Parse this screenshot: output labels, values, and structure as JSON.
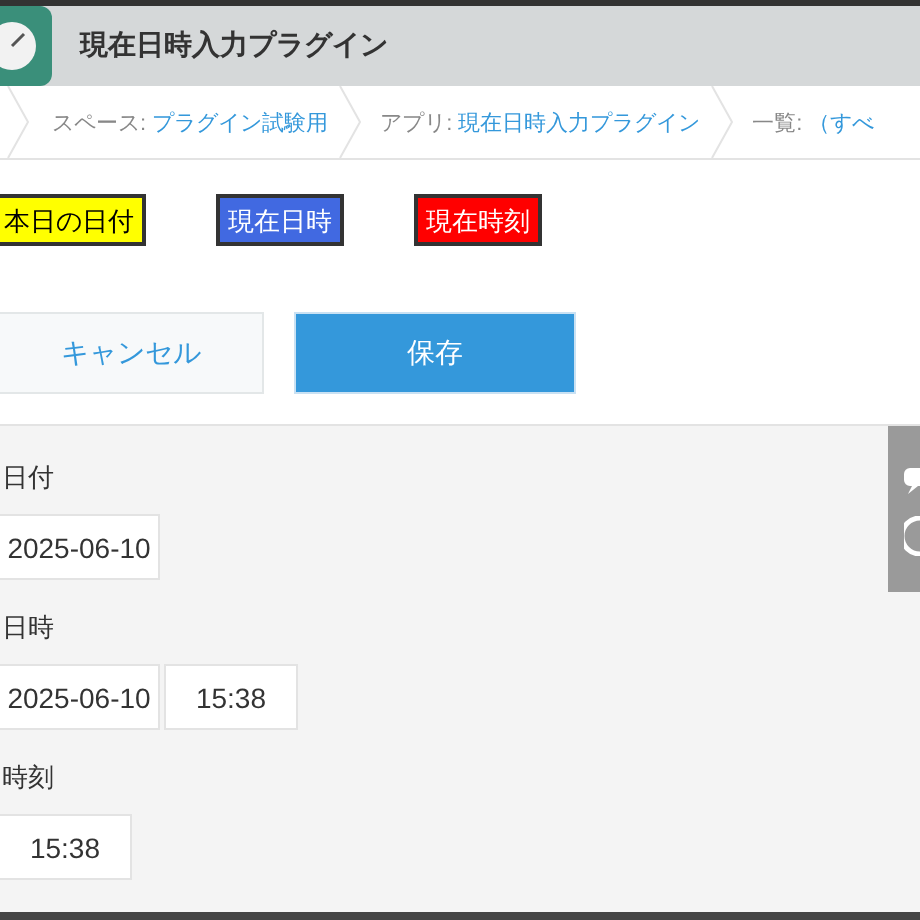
{
  "header": {
    "title": "現在日時入力プラグイン"
  },
  "breadcrumbs": [
    {
      "label": "スペース:",
      "value": "プラグイン試験用"
    },
    {
      "label": "アプリ:",
      "value": "現在日時入力プラグイン"
    },
    {
      "label": "一覧:",
      "value": "（すべ"
    }
  ],
  "custom_buttons": [
    {
      "label": "本日の日付",
      "color": "#ffff00"
    },
    {
      "label": "現在日時",
      "color": "#4169e1"
    },
    {
      "label": "現在時刻",
      "color": "#ff0000"
    }
  ],
  "actions": [
    {
      "label": "キャンセル",
      "kind": "secondary"
    },
    {
      "label": "保存",
      "kind": "primary"
    }
  ],
  "fields": [
    {
      "label": "日付",
      "date": "2025-06-10"
    },
    {
      "label": "日時",
      "date": "2025-06-10",
      "time": "15:38"
    },
    {
      "label": "時刻",
      "time": "15:38"
    }
  ]
}
